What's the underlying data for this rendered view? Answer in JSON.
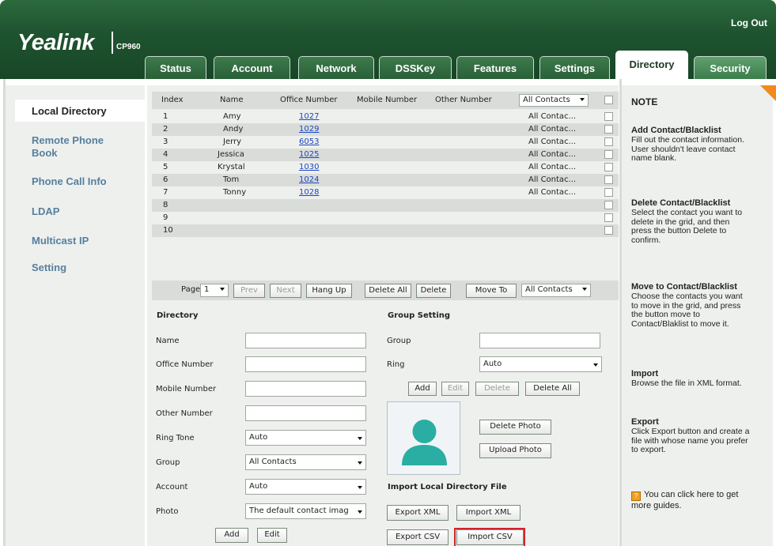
{
  "header": {
    "logo": "Yealink",
    "model": "CP960",
    "logout": "Log Out",
    "tabs": [
      "Status",
      "Account",
      "Network",
      "DSSKey",
      "Features",
      "Settings",
      "Directory",
      "Security"
    ],
    "active_tab": "Directory"
  },
  "sidebar": {
    "items": [
      "Local Directory",
      "Remote Phone Book",
      "Phone Call Info",
      "LDAP",
      "Multicast IP",
      "Setting"
    ],
    "remote_line1": "Remote Phone",
    "remote_line2": "Book"
  },
  "grid": {
    "headers": {
      "index": "Index",
      "name": "Name",
      "office": "Office Number",
      "mobile": "Mobile Number",
      "other": "Other Number",
      "filter": "All Contacts"
    },
    "rows": [
      {
        "index": "1",
        "name": "Amy",
        "office": "1027",
        "group": "All Contac..."
      },
      {
        "index": "2",
        "name": "Andy",
        "office": "1029",
        "group": "All Contac..."
      },
      {
        "index": "3",
        "name": "Jerry",
        "office": "6053",
        "group": "All Contac..."
      },
      {
        "index": "4",
        "name": "Jessica",
        "office": "1025",
        "group": "All Contac..."
      },
      {
        "index": "5",
        "name": "Krystal",
        "office": "1030",
        "group": "All Contac..."
      },
      {
        "index": "6",
        "name": "Tom",
        "office": "1024",
        "group": "All Contac..."
      },
      {
        "index": "7",
        "name": "Tonny",
        "office": "1028",
        "group": "All Contac..."
      },
      {
        "index": "8",
        "name": "",
        "office": "",
        "group": ""
      },
      {
        "index": "9",
        "name": "",
        "office": "",
        "group": ""
      },
      {
        "index": "10",
        "name": "",
        "office": "",
        "group": ""
      }
    ]
  },
  "pager": {
    "page_label": "Page",
    "page_value": "1",
    "prev": "Prev",
    "next": "Next",
    "hang_up": "Hang Up",
    "delete_all": "Delete All",
    "delete": "Delete",
    "move_to": "Move To",
    "move_target": "All Contacts"
  },
  "directory_form": {
    "title": "Directory",
    "name_label": "Name",
    "office_label": "Office Number",
    "mobile_label": "Mobile Number",
    "other_label": "Other Number",
    "ringtone_label": "Ring Tone",
    "ringtone_value": "Auto",
    "group_label": "Group",
    "group_value": "All Contacts",
    "account_label": "Account",
    "account_value": "Auto",
    "photo_label": "Photo",
    "photo_value": "The default contact imag",
    "add": "Add",
    "edit": "Edit"
  },
  "group_setting": {
    "title": "Group Setting",
    "group_label": "Group",
    "ring_label": "Ring",
    "ring_value": "Auto",
    "add": "Add",
    "edit": "Edit",
    "delete": "Delete",
    "delete_all": "Delete All",
    "delete_photo": "Delete Photo",
    "upload_photo": "Upload Photo",
    "import_title": "Import Local Directory File",
    "export_xml": "Export XML",
    "import_xml": "Import XML",
    "export_csv": "Export CSV",
    "import_csv": "Import CSV"
  },
  "note": {
    "title": "NOTE",
    "sections": [
      {
        "heading": "Add Contact/Blacklist",
        "lines": [
          "Fill out the contact information.",
          "User shouldn't leave contact",
          "name blank."
        ]
      },
      {
        "heading": "Delete Contact/Blacklist",
        "lines": [
          "Select the contact you want to",
          "delete in the grid, and then",
          "press the button Delete to",
          "confirm."
        ]
      },
      {
        "heading": "Move to Contact/Blacklist",
        "lines": [
          "Choose the contacts you want",
          "to move in the grid, and press",
          "the button move to",
          "Contact/Blaklist to move it."
        ]
      },
      {
        "heading": "Import",
        "lines": [
          "Browse the file in XML format."
        ]
      },
      {
        "heading": "Export",
        "lines": [
          "Click Export button and create a",
          "file with whose name you prefer",
          "to export."
        ]
      }
    ],
    "guide_line1": "You can click here to get",
    "guide_line2": "more guides."
  },
  "colors": {
    "header_green": "#1f5430",
    "link_blue": "#1a47c0",
    "sidebar_link": "#567f9e",
    "highlight_red": "#d1242a",
    "note_corner": "#f08a1c"
  }
}
